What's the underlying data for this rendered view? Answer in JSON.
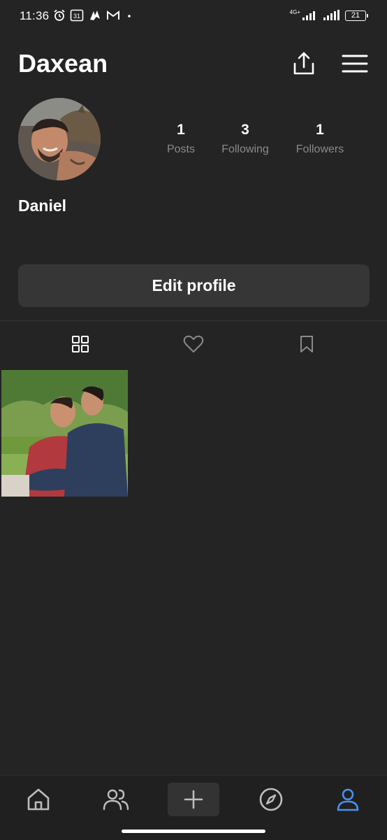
{
  "status_bar": {
    "time": "11:36",
    "calendar_day": "31",
    "network_type": "4G+",
    "battery_level": "21"
  },
  "header": {
    "username": "Daxean"
  },
  "profile": {
    "display_name": "Daniel",
    "stats": [
      {
        "value": "1",
        "label": "Posts"
      },
      {
        "value": "3",
        "label": "Following"
      },
      {
        "value": "1",
        "label": "Followers"
      }
    ],
    "edit_label": "Edit profile"
  },
  "tabs": [
    {
      "icon": "grid-icon",
      "active": true
    },
    {
      "icon": "heart-icon",
      "active": false
    },
    {
      "icon": "bookmark-icon",
      "active": false
    }
  ],
  "bottom_nav": [
    {
      "icon": "home-icon",
      "active": false
    },
    {
      "icon": "people-icon",
      "active": false
    },
    {
      "icon": "plus-icon",
      "active": false
    },
    {
      "icon": "compass-icon",
      "active": false
    },
    {
      "icon": "profile-icon",
      "active": true
    }
  ],
  "colors": {
    "background": "#242424",
    "muted_text": "#8a8a8a",
    "accent": "#4a90f0",
    "button": "#363636"
  }
}
